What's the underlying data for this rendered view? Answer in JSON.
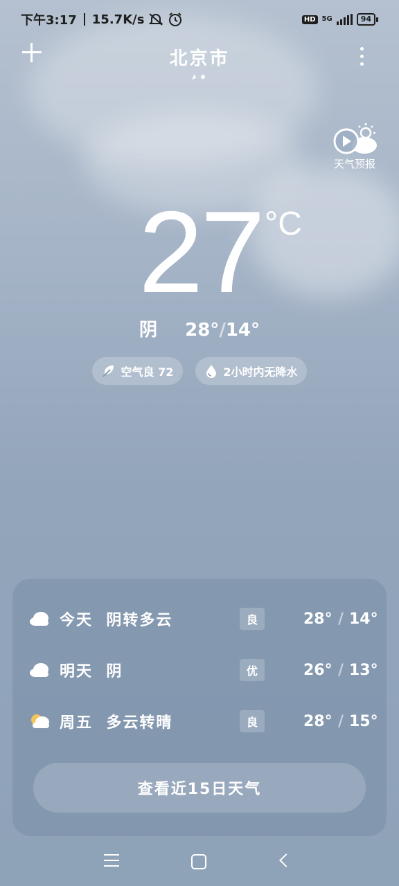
{
  "status_bar": {
    "time": "下午3:17",
    "net_speed": "15.7K/s",
    "hd": "HD",
    "network": "5G",
    "battery": "94"
  },
  "header": {
    "city": "北京市"
  },
  "video_forecast": {
    "label": "天气预报"
  },
  "current": {
    "temperature": "27",
    "unit": "°C",
    "condition": "阴",
    "high": "28°",
    "low": "14°"
  },
  "pills": {
    "air": "空气良 72",
    "rain": "2小时内无降水"
  },
  "forecast": {
    "days": [
      {
        "day": "今天",
        "condition": "阴转多云",
        "icon": "cloud-icon",
        "quality": "良",
        "high": "28°",
        "low": "14°"
      },
      {
        "day": "明天",
        "condition": "阴",
        "icon": "cloud-icon",
        "quality": "优",
        "high": "26°",
        "low": "13°"
      },
      {
        "day": "周五",
        "condition": "多云转晴",
        "icon": "partly-sunny-icon",
        "quality": "良",
        "high": "28°",
        "low": "15°"
      }
    ],
    "button": "查看近15日天气"
  }
}
